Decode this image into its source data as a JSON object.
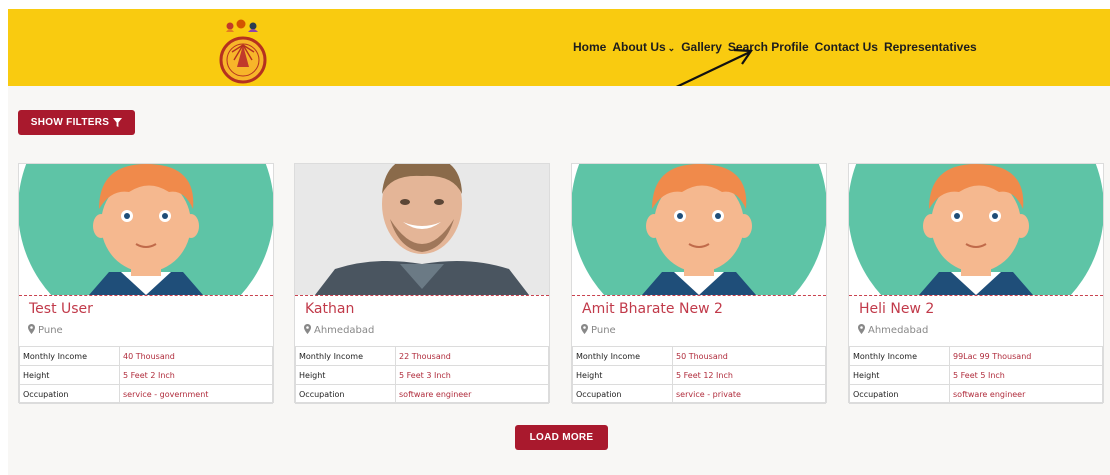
{
  "header": {
    "bg_color": "#f9cb10",
    "logo_icon": "matrimony-logo-icon",
    "nav": [
      {
        "label": "Home",
        "dropdown": false
      },
      {
        "label": "About Us",
        "dropdown": true
      },
      {
        "label": "Gallery",
        "dropdown": false
      },
      {
        "label": "Search Profile",
        "dropdown": false
      },
      {
        "label": "Contact Us",
        "dropdown": false
      },
      {
        "label": "Representatives",
        "dropdown": false
      }
    ]
  },
  "filters": {
    "show_filters_label": "SHOW FILTERS",
    "icon": "filter-icon",
    "color": "#a9192d"
  },
  "profiles": [
    {
      "name": "Test User",
      "location": "Pune",
      "photo": "avatar",
      "rows": [
        [
          "Monthly Income",
          "40 Thousand"
        ],
        [
          "Height",
          "5 Feet 2 Inch"
        ],
        [
          "Occupation",
          "service - government"
        ]
      ]
    },
    {
      "name": "Kathan",
      "location": "Ahmedabad",
      "photo": "photo",
      "rows": [
        [
          "Monthly Income",
          "22 Thousand"
        ],
        [
          "Height",
          "5 Feet 3 Inch"
        ],
        [
          "Occupation",
          "software engineer"
        ]
      ]
    },
    {
      "name": "Amit Bharate New 2",
      "location": "Pune",
      "photo": "avatar",
      "rows": [
        [
          "Monthly Income",
          "50 Thousand"
        ],
        [
          "Height",
          "5 Feet 12 Inch"
        ],
        [
          "Occupation",
          "service - private"
        ]
      ]
    },
    {
      "name": "Heli New 2",
      "location": "Ahmedabad",
      "photo": "avatar",
      "rows": [
        [
          "Monthly Income",
          "99Lac 99 Thousand"
        ],
        [
          "Height",
          "5 Feet 5 Inch"
        ],
        [
          "Occupation",
          "software engineer"
        ]
      ]
    }
  ],
  "load_more": {
    "label": "LOAD MORE"
  }
}
